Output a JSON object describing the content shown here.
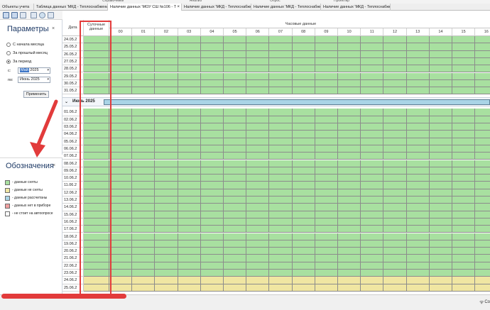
{
  "menu": {
    "items": [
      "Справочники",
      "Анализ",
      "Опрос",
      "Проектир"
    ]
  },
  "tabs": [
    {
      "label": "Объекты учета",
      "closable": false
    },
    {
      "label": "Таблица данных 'МКД - Теплоснабжени",
      "closable": false
    },
    {
      "label": "Наличие данных 'МОУ СШ №106 - Т",
      "closable": true,
      "active": true
    },
    {
      "label": "Наличие данных 'МКД - Теплоснабжени",
      "closable": false
    },
    {
      "label": "Наличие данных 'МКД - Теплоснабжени",
      "closable": false
    },
    {
      "label": "Наличие данных 'МКД - Теплоснабжени",
      "closable": false
    }
  ],
  "params": {
    "title": "Параметры",
    "close": "×",
    "radios": [
      {
        "label": "С начала месяца",
        "checked": false
      },
      {
        "label": "За прошлый месяц",
        "checked": false
      },
      {
        "label": "За период",
        "checked": true
      }
    ],
    "from_label": "с:",
    "from_hl": "Май",
    "from_rest": " 2025",
    "to_label": "по:",
    "to_value": "Июнь 2025",
    "apply": "Применить"
  },
  "legend": {
    "title": "Обозначения",
    "close": "×",
    "items": [
      {
        "label": "- данные сняты",
        "color": "#a8e0a0"
      },
      {
        "label": "- данные не сняты",
        "color": "#f0e6a2"
      },
      {
        "label": "- данные рассчитаны",
        "color": "#a9d4e6"
      },
      {
        "label": "- данных нет в приборе",
        "color": "#f0a0a0"
      },
      {
        "label": "- не стоит на автоопросе",
        "color": "#ffffff"
      }
    ]
  },
  "grid": {
    "col_date": "Дата",
    "col_daily": "Суточные данные",
    "col_hourly": "Часовые данные",
    "hours": [
      "00",
      "01",
      "02",
      "03",
      "04",
      "05",
      "06",
      "07",
      "08",
      "09",
      "10",
      "11",
      "12",
      "13",
      "14",
      "15",
      "16"
    ],
    "may_rows": [
      "24.05.2",
      "25.05.2",
      "26.05.2",
      "27.05.2",
      "28.05.2",
      "29.05.2",
      "30.05.2",
      "31.05.2"
    ],
    "group_label": "Июнь 2025",
    "group_symbol": "⌄",
    "june_rows": [
      "01.06.2",
      "02.06.2",
      "03.06.2",
      "04.06.2",
      "05.06.2",
      "06.06.2",
      "07.06.2",
      "08.06.2",
      "09.06.2",
      "10.06.2",
      "11.06.2",
      "12.06.2",
      "13.06.2",
      "14.06.2",
      "15.06.2",
      "16.06.2",
      "17.06.2",
      "18.06.2",
      "19.06.2",
      "20.06.2",
      "21.06.2",
      "22.06.2",
      "23.06.2",
      "24.06.2",
      "25.06.2"
    ],
    "colors": {
      "green": "#a8e0a0",
      "yellow": "#f0e6a2",
      "blue": "#a9d4e6"
    }
  },
  "status": {
    "text": "Со"
  }
}
